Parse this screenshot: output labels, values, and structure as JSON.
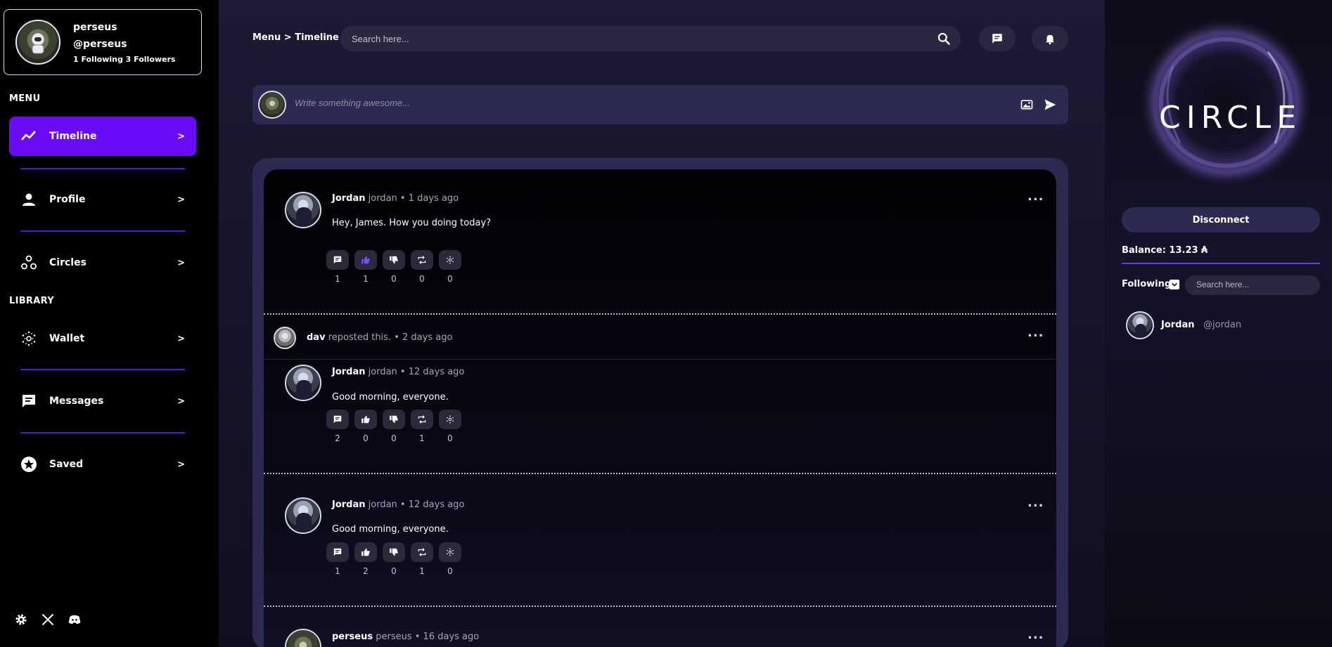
{
  "user": {
    "name": "perseus",
    "handle": "@perseus",
    "stats": "1 Following 3 Followers"
  },
  "sidebar": {
    "menu_label": "MENU",
    "library_label": "LIBRARY",
    "chevron": ">",
    "items": [
      {
        "label": "Timeline",
        "icon": "trending-icon",
        "active": true
      },
      {
        "label": "Profile",
        "icon": "user-icon"
      },
      {
        "label": "Circles",
        "icon": "circles-icon"
      },
      {
        "label": "Wallet",
        "icon": "cardano-icon"
      },
      {
        "label": "Messages",
        "icon": "message-icon"
      },
      {
        "label": "Saved",
        "icon": "star-icon"
      }
    ],
    "footer_icons": [
      "gear-icon",
      "x-icon",
      "discord-icon"
    ]
  },
  "header": {
    "breadcrumb": "Menu > Timeline",
    "search_placeholder": "Search here..."
  },
  "composer": {
    "placeholder": "Write something awesome..."
  },
  "posts": [
    {
      "author": "Jordan",
      "meta": "jordan • 1 days ago",
      "text": "Hey, James. How you doing today?",
      "counts": [
        "1",
        "1",
        "0",
        "0",
        "0"
      ],
      "liked": true
    },
    {
      "repost_by": "dav",
      "repost_meta": "reposted this. • 2 days ago",
      "author": "Jordan",
      "meta": "jordan • 12 days ago",
      "text": "Good morning, everyone.",
      "counts": [
        "2",
        "0",
        "0",
        "1",
        "0"
      ]
    },
    {
      "author": "Jordan",
      "meta": "jordan • 12 days ago",
      "text": "Good morning, everyone.",
      "counts": [
        "1",
        "2",
        "0",
        "1",
        "0"
      ]
    },
    {
      "author": "perseus",
      "meta": "perseus • 16 days ago"
    }
  ],
  "more_glyph": "...",
  "right_panel": {
    "logo": "CIRCLE",
    "disconnect_label": "Disconnect",
    "balance": "Balance: 13.23 ₳",
    "following_label": "Following",
    "search_placeholder": "Search here...",
    "following": [
      {
        "name": "Jordan",
        "handle": "@jordan"
      }
    ]
  },
  "colors": {
    "accent": "#6a0bf5",
    "divider": "#4b18d8",
    "panel": "#2c2a50",
    "liked": "#7b4dff"
  }
}
